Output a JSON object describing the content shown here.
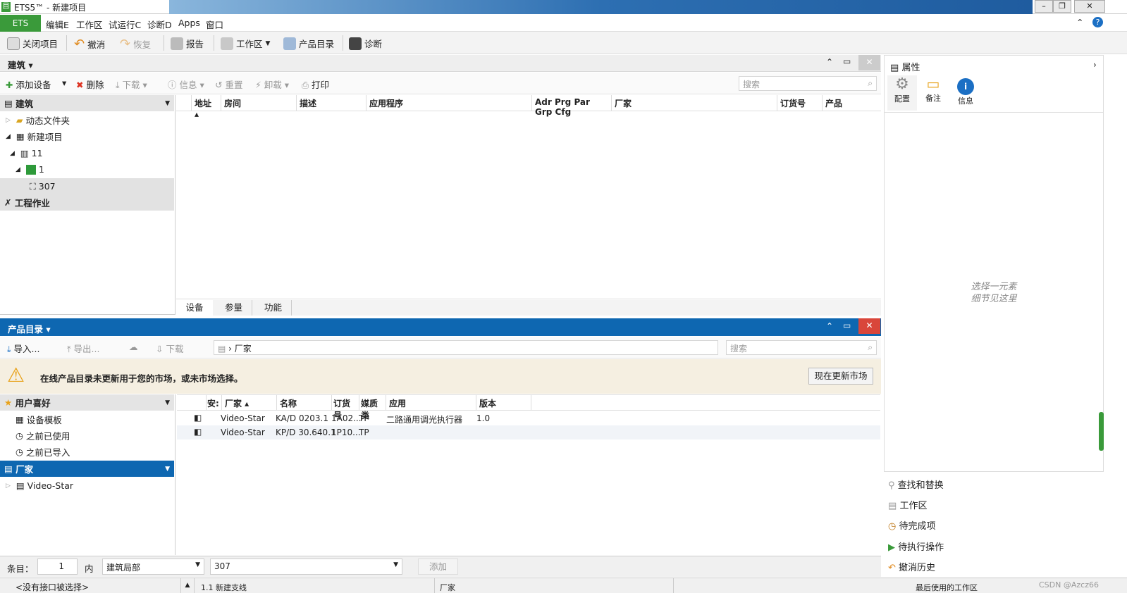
{
  "window": {
    "title": "ETS5™ - 新建项目"
  },
  "menu": {
    "app": "ETS",
    "items": [
      "编辑E",
      "工作区",
      "试运行C",
      "诊断D",
      "Apps",
      "窗口"
    ]
  },
  "toolbar": {
    "close_project": "关闭项目",
    "undo": "撤消",
    "redo": "恢复",
    "report": "报告",
    "workspace": "工作区",
    "catalog": "产品目录",
    "diagnostics": "诊断"
  },
  "building": {
    "title": "建筑",
    "actions": {
      "add_device": "添加设备",
      "delete": "删除",
      "download": "下载",
      "info": "信息",
      "reset": "重置",
      "unload": "卸载",
      "print": "打印"
    },
    "search_placeholder": "搜索",
    "tree_header": "建筑",
    "tree": [
      "动态文件夹",
      "新建项目",
      "11",
      "1",
      "307",
      "工程作业"
    ],
    "columns": [
      "地址 ▴",
      "房间",
      "描述",
      "应用程序",
      "Adr Prg Par Grp Cfg",
      "厂家",
      "订货号",
      "产品"
    ],
    "tabs": [
      "设备",
      "参量",
      "功能"
    ]
  },
  "catalog": {
    "title": "产品目录",
    "actions": {
      "import": "导入...",
      "export": "导出...",
      "download": "下载"
    },
    "breadcrumb": "厂家",
    "search_placeholder": "搜索",
    "warning": "在线产品目录未更新用于您的市场，或未市场选择。",
    "update_button": "现在更新市场",
    "favorites_header": "用户喜好",
    "favorites": [
      "设备模板",
      "之前已使用",
      "之前已导入"
    ],
    "manufacturer_header": "厂家",
    "manufacturers": [
      "Video-Star"
    ],
    "columns": [
      "安:",
      "厂家 ▴",
      "名称",
      "订货号",
      "媒质类",
      "应用",
      "版本"
    ],
    "rows": [
      {
        "mfr": "Video-Star",
        "name": "KA/D 0203.1",
        "order": "1A02...",
        "medium": "TP",
        "app": "二路通用调光执行器",
        "version": "1.0"
      },
      {
        "mfr": "Video-Star",
        "name": "KP/D 30.640.1",
        "order": "1P10...",
        "medium": "TP",
        "app": "",
        "version": ""
      }
    ]
  },
  "bottom": {
    "items_label": "条目：",
    "count": "1",
    "in_label": "内",
    "scope": "建筑局部",
    "location": "307",
    "add": "添加"
  },
  "properties": {
    "title": "属性",
    "tabs": [
      "配置",
      "备注",
      "信息"
    ],
    "empty_line1": "选择一元素",
    "empty_line2": "细节见这里",
    "links": [
      "查找和替换",
      "工作区",
      "待完成项",
      "待执行操作",
      "撤消历史"
    ]
  },
  "status": {
    "interface": "<没有接口被选择>",
    "line": "1.1 新建支线",
    "mfr": "厂家",
    "workspace": "最后使用的工作区",
    "watermark": "CSDN @Azcz66"
  }
}
